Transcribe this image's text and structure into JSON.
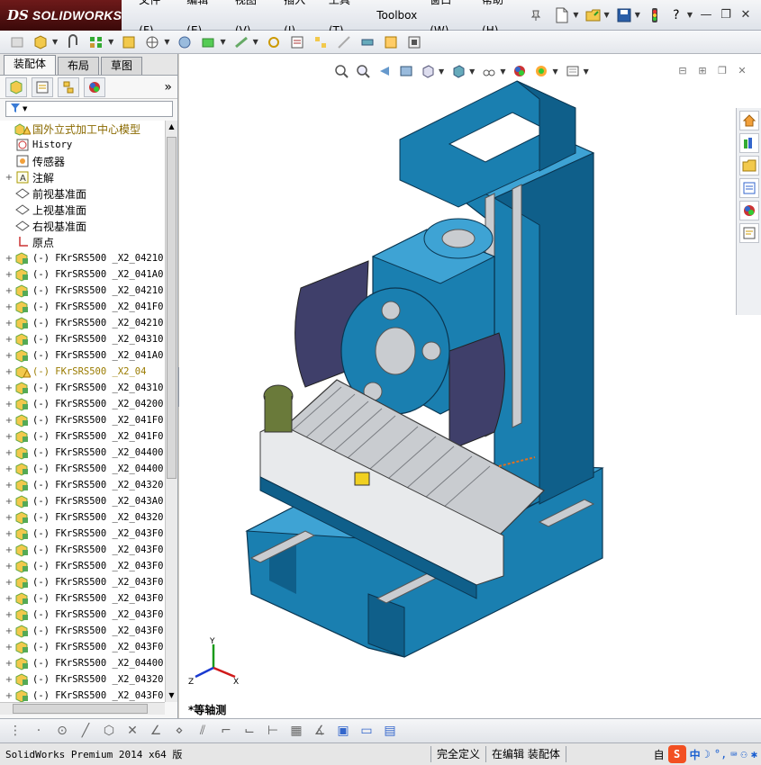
{
  "app": {
    "logo_ds": "DS",
    "logo_name": "SOLIDWORKS"
  },
  "menu": [
    {
      "label": "文件(F)"
    },
    {
      "label": "编辑(E)"
    },
    {
      "label": "视图(V)"
    },
    {
      "label": "插入(I)"
    },
    {
      "label": "工具(T)"
    },
    {
      "label": "Toolbox"
    },
    {
      "label": "窗口(W)"
    },
    {
      "label": "帮助(H)"
    }
  ],
  "feature_manager": {
    "tabs": [
      {
        "label": "装配体",
        "active": true
      },
      {
        "label": "布局",
        "active": false
      },
      {
        "label": "草图",
        "active": false
      }
    ],
    "tree": [
      {
        "expand": "",
        "icon": "assembly-warning",
        "label": "国外立式加工中心模型",
        "style": "title"
      },
      {
        "expand": "",
        "icon": "history",
        "label": "History",
        "style": "mono"
      },
      {
        "expand": "",
        "icon": "sensor",
        "label": "传感器",
        "style": ""
      },
      {
        "expand": "+",
        "icon": "annotation",
        "label": "注解",
        "style": ""
      },
      {
        "expand": "",
        "icon": "plane",
        "label": "前视基准面",
        "style": ""
      },
      {
        "expand": "",
        "icon": "plane",
        "label": "上视基准面",
        "style": ""
      },
      {
        "expand": "",
        "icon": "plane",
        "label": "右视基准面",
        "style": ""
      },
      {
        "expand": "",
        "icon": "origin",
        "label": "原点",
        "style": ""
      },
      {
        "expand": "+",
        "icon": "sub-asm",
        "label": "(-) FKrSRS500 _X2_04210",
        "style": "mono"
      },
      {
        "expand": "+",
        "icon": "sub-asm",
        "label": "(-) FKrSRS500 _X2_041A0",
        "style": "mono"
      },
      {
        "expand": "+",
        "icon": "sub-asm",
        "label": "(-) FKrSRS500 _X2_04210",
        "style": "mono"
      },
      {
        "expand": "+",
        "icon": "sub-asm",
        "label": "(-) FKrSRS500 _X2_041F0",
        "style": "mono"
      },
      {
        "expand": "+",
        "icon": "sub-asm",
        "label": "(-) FKrSRS500 _X2_04210",
        "style": "mono"
      },
      {
        "expand": "+",
        "icon": "sub-asm",
        "label": "(-) FKrSRS500 _X2_04310",
        "style": "mono"
      },
      {
        "expand": "+",
        "icon": "sub-asm",
        "label": "(-) FKrSRS500 _X2_041A0",
        "style": "mono"
      },
      {
        "expand": "+",
        "icon": "sub-asm-warning",
        "label": "(-) FKrSRS500 _X2_04",
        "style": "mono warn"
      },
      {
        "expand": "+",
        "icon": "sub-asm",
        "label": "(-) FKrSRS500 _X2_04310",
        "style": "mono"
      },
      {
        "expand": "+",
        "icon": "sub-asm",
        "label": "(-) FKrSRS500 _X2_04200",
        "style": "mono"
      },
      {
        "expand": "+",
        "icon": "sub-asm",
        "label": "(-) FKrSRS500 _X2_041F0",
        "style": "mono"
      },
      {
        "expand": "+",
        "icon": "sub-asm",
        "label": "(-) FKrSRS500 _X2_041F0",
        "style": "mono"
      },
      {
        "expand": "+",
        "icon": "sub-asm",
        "label": "(-) FKrSRS500 _X2_04400",
        "style": "mono"
      },
      {
        "expand": "+",
        "icon": "sub-asm",
        "label": "(-) FKrSRS500 _X2_04400",
        "style": "mono"
      },
      {
        "expand": "+",
        "icon": "sub-asm",
        "label": "(-) FKrSRS500 _X2_04320",
        "style": "mono"
      },
      {
        "expand": "+",
        "icon": "sub-asm",
        "label": "(-) FKrSRS500 _X2_043A0",
        "style": "mono"
      },
      {
        "expand": "+",
        "icon": "sub-asm",
        "label": "(-) FKrSRS500 _X2_04320",
        "style": "mono"
      },
      {
        "expand": "+",
        "icon": "sub-asm",
        "label": "(-) FKrSRS500 _X2_043F0",
        "style": "mono"
      },
      {
        "expand": "+",
        "icon": "sub-asm",
        "label": "(-) FKrSRS500 _X2_043F0",
        "style": "mono"
      },
      {
        "expand": "+",
        "icon": "sub-asm",
        "label": "(-) FKrSRS500 _X2_043F0",
        "style": "mono"
      },
      {
        "expand": "+",
        "icon": "sub-asm",
        "label": "(-) FKrSRS500 _X2_043F0",
        "style": "mono"
      },
      {
        "expand": "+",
        "icon": "sub-asm",
        "label": "(-) FKrSRS500 _X2_043F0",
        "style": "mono"
      },
      {
        "expand": "+",
        "icon": "sub-asm",
        "label": "(-) FKrSRS500 _X2_043F0",
        "style": "mono"
      },
      {
        "expand": "+",
        "icon": "sub-asm",
        "label": "(-) FKrSRS500 _X2_043F0",
        "style": "mono"
      },
      {
        "expand": "+",
        "icon": "sub-asm",
        "label": "(-) FKrSRS500 _X2_043F0",
        "style": "mono"
      },
      {
        "expand": "+",
        "icon": "sub-asm",
        "label": "(-) FKrSRS500 _X2_04400",
        "style": "mono"
      },
      {
        "expand": "+",
        "icon": "sub-asm",
        "label": "(-) FKrSRS500 _X2_04320",
        "style": "mono"
      },
      {
        "expand": "+",
        "icon": "sub-asm",
        "label": "(-) FKrSRS500 _X2_043F0",
        "style": "mono"
      }
    ]
  },
  "viewport": {
    "view_name": "*等轴测",
    "triad": {
      "x": "X",
      "y": "Y",
      "z": "Z"
    }
  },
  "status": {
    "product": "SolidWorks Premium 2014 x64 版",
    "definition": "完全定义",
    "mode": "在编辑 装配体",
    "ime_prefix": "自",
    "ime_lang": "中"
  },
  "colors": {
    "machine_blue": "#1a7fb0",
    "machine_blue_dark": "#0f5f8a",
    "machine_blue_light": "#3ea3d4",
    "steel": "#c9ccd0",
    "guard": "#3f3f6a"
  }
}
